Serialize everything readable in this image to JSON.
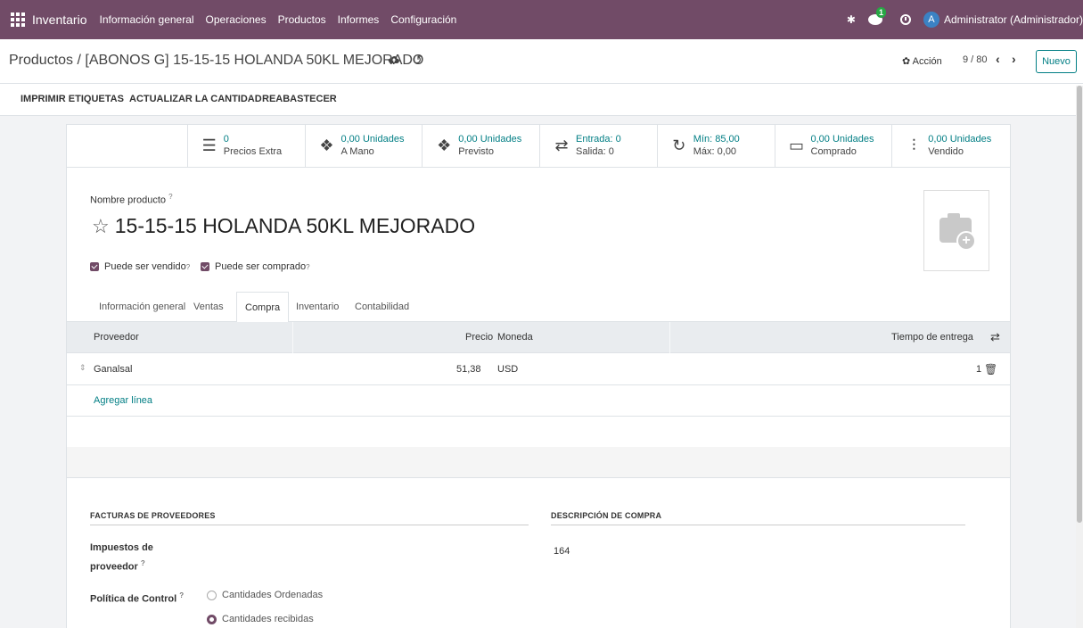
{
  "navbar": {
    "app_name": "Inventario",
    "menu": [
      "Información general",
      "Operaciones",
      "Productos",
      "Informes",
      "Configuración"
    ],
    "chat_badge": "1",
    "avatar_initial": "A",
    "user_name": "Administrator (Administrador)"
  },
  "control": {
    "breadcrumb": "Productos / [ABONOS G] 15-15-15 HOLANDA 50KL MEJORADO",
    "action_label": "Acción",
    "pager": "9 / 80",
    "new_label": "Nuevo"
  },
  "buttons": [
    "IMPRIMIR ETIQUETAS",
    "ACTUALIZAR LA CANTIDAD",
    "REABASTECER"
  ],
  "stats": [
    {
      "icon": "list-icon",
      "value": "0",
      "label": "Precios Extra"
    },
    {
      "icon": "cubes-icon",
      "value": "0,00 Unidades",
      "label": "A Mano"
    },
    {
      "icon": "cubes-icon",
      "value": "0,00 Unidades",
      "label": "Previsto"
    },
    {
      "icon": "exchange-icon",
      "value": "Entrada:  0",
      "label": "Salida:   0"
    },
    {
      "icon": "refresh-icon",
      "value": "Mín:  85,00",
      "label": "Máx:  0,00"
    },
    {
      "icon": "credit-card-icon",
      "value": "0,00 Unidades",
      "label": "Comprado"
    },
    {
      "icon": "signal-icon",
      "value": "0,00 Unidades",
      "label": "Vendido"
    }
  ],
  "product": {
    "name_label": "Nombre producto",
    "help_mark": "?",
    "name": "15-15-15 HOLANDA 50KL MEJORADO",
    "can_be_sold": "Puede ser vendido",
    "can_be_purchased": "Puede ser comprado"
  },
  "tabs": [
    "Información general",
    "Ventas",
    "Compra",
    "Inventario",
    "Contabilidad"
  ],
  "vendor_table": {
    "headers": {
      "vendor": "Proveedor",
      "price": "Precio",
      "currency": "Moneda",
      "lead_time": "Tiempo de entrega"
    },
    "rows": [
      {
        "vendor": "Ganalsal",
        "price": "51,38",
        "currency": "USD",
        "lead_time": "1"
      }
    ],
    "add_line": "Agregar línea"
  },
  "sections": {
    "vendor_bills": "FACTURAS DE PROVEEDORES",
    "purchase_description": "DESCRIPCIÓN DE COMPRA",
    "vendor_taxes_label_1": "Impuestos de",
    "vendor_taxes_label_2": "proveedor",
    "description_value": "164",
    "control_policy_label": "Política de Control",
    "radio_ordered": "Cantidades Ordenadas",
    "radio_received": "Cantidades recibidas"
  }
}
